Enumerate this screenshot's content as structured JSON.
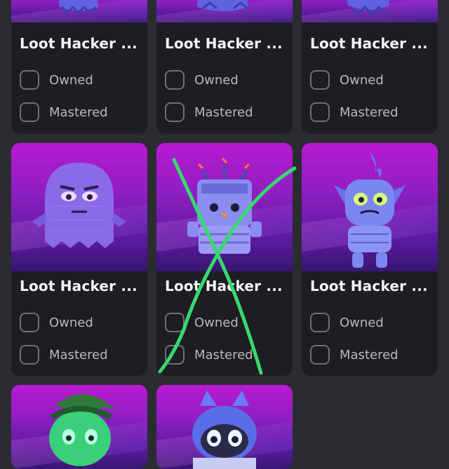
{
  "cards": [
    {
      "title": "Loot Hacker ...",
      "owned_label": "Owned",
      "mastered_label": "Mastered",
      "art_icon": "robot-character-icon"
    },
    {
      "title": "Loot Hacker ...",
      "owned_label": "Owned",
      "mastered_label": "Mastered",
      "art_icon": "robot-character-icon"
    },
    {
      "title": "Loot Hacker ...",
      "owned_label": "Owned",
      "mastered_label": "Mastered",
      "art_icon": "robot-character-icon"
    },
    {
      "title": "Loot Hacker ...",
      "owned_label": "Owned",
      "mastered_label": "Mastered",
      "art_icon": "ghost-character-icon"
    },
    {
      "title": "Loot Hacker ...",
      "owned_label": "Owned",
      "mastered_label": "Mastered",
      "art_icon": "box-robot-character-icon"
    },
    {
      "title": "Loot Hacker ...",
      "owned_label": "Owned",
      "mastered_label": "Mastered",
      "art_icon": "goblin-character-icon"
    },
    {
      "art_icon": "green-blob-character-icon"
    },
    {
      "art_icon": "blue-cat-character-icon"
    }
  ],
  "colors": {
    "page_bg": "#2b2c31",
    "card_bg": "#1d1e22",
    "art_top": "#b81ad2",
    "cross_mark": "#39d86f"
  }
}
